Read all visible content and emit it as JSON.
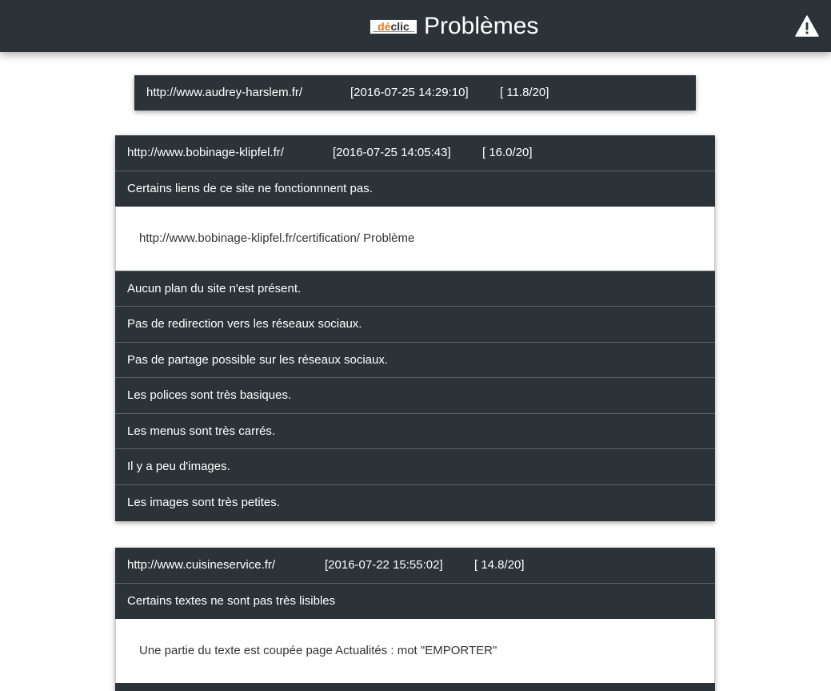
{
  "header": {
    "logo_part1": "dé",
    "logo_part2": "clic",
    "title": "Problèmes",
    "warning_icon": "warning-triangle-icon"
  },
  "sites": [
    {
      "url": "http://www.audrey-harslem.fr/",
      "date": "[2016-07-25 14:29:10]",
      "score": "[ 11.8/20]"
    },
    {
      "url": "http://www.bobinage-klipfel.fr/",
      "date": "[2016-07-25 14:05:43]",
      "score": "[ 16.0/20]",
      "problems": [
        {
          "label": "Certains liens de ce site ne fonctionnnent pas.",
          "detail": "http://www.bobinage-klipfel.fr/certification/ Problème"
        },
        {
          "label": "Aucun plan du site n'est présent."
        },
        {
          "label": "Pas de redirection vers les réseaux sociaux."
        },
        {
          "label": "Pas de partage possible sur les réseaux sociaux."
        },
        {
          "label": "Les polices sont très basiques."
        },
        {
          "label": "Les menus sont très carrés."
        },
        {
          "label": "Il y a peu d'images."
        },
        {
          "label": "Les images sont très petites."
        }
      ]
    },
    {
      "url": "http://www.cuisineservice.fr/",
      "date": "[2016-07-22 15:55:02]",
      "score": "[ 14.8/20]",
      "problems": [
        {
          "label": "Certains textes ne sont pas très lisibles",
          "detail": "Une partie du texte est coupée page Actualités : mot \"EMPORTER\""
        }
      ]
    }
  ]
}
